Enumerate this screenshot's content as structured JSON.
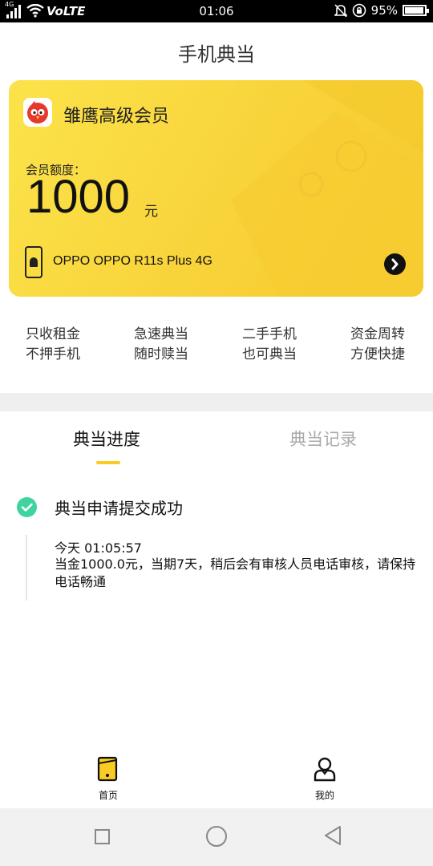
{
  "status_bar": {
    "network": "4G",
    "volte": "VoLTE",
    "time": "01:06",
    "battery": "95%",
    "battery_level": 0.95
  },
  "header": {
    "title": "手机典当"
  },
  "card": {
    "brand": "雏鹰高级会员",
    "quota_label": "会员额度：",
    "quota_amount": "1000",
    "quota_unit": "元",
    "device": "OPPO OPPO R11s Plus 4G"
  },
  "features": [
    {
      "line1": "只收租金",
      "line2": "不押手机"
    },
    {
      "line1": "急速典当",
      "line2": "随时赎当"
    },
    {
      "line1": "二手手机",
      "line2": "也可典当"
    },
    {
      "line1": "资金周转",
      "line2": "方便快捷"
    }
  ],
  "tabs": [
    {
      "label": "典当进度",
      "active": true
    },
    {
      "label": "典当记录",
      "active": false
    }
  ],
  "progress": {
    "title": "典当申请提交成功",
    "time": "今天 01:05:57",
    "detail": "当金1000.0元，当期7天，稍后会有审核人员电话审核，请保持电话畅通"
  },
  "bottom_nav": [
    {
      "label": "首页",
      "icon": "home-phone-icon"
    },
    {
      "label": "我的",
      "icon": "person-icon"
    }
  ],
  "colors": {
    "card_yellow": "#f8d33a",
    "accent_yellow": "#f9cc24",
    "success_green": "#3fd49f"
  }
}
